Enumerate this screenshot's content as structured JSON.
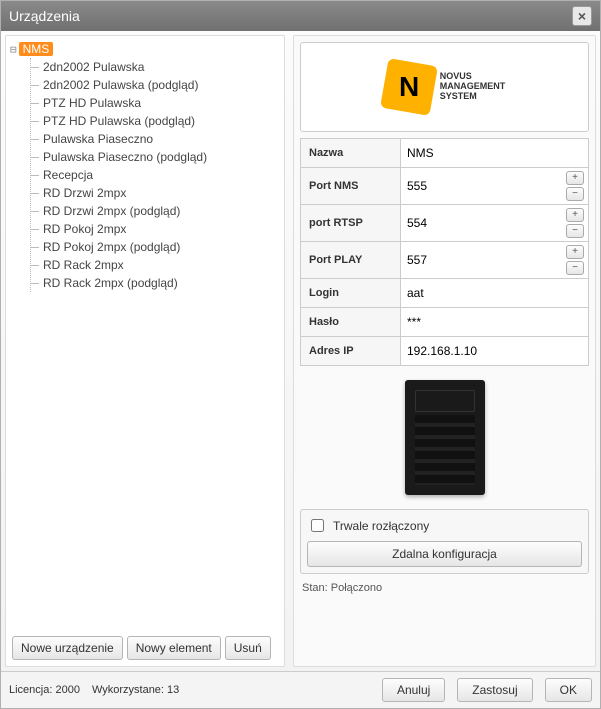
{
  "window": {
    "title": "Urządzenia"
  },
  "tree": {
    "root": "NMS",
    "items": [
      "2dn2002 Pulawska",
      "2dn2002 Pulawska (podgląd)",
      "PTZ HD Pulawska",
      "PTZ HD Pulawska (podgląd)",
      "Pulawska Piaseczno",
      "Pulawska Piaseczno (podgląd)",
      "Recepcja",
      "RD Drzwi 2mpx",
      "RD Drzwi 2mpx (podgląd)",
      "RD Pokoj 2mpx",
      "RD Pokoj 2mpx (podgląd)",
      "RD Rack 2mpx",
      "RD Rack 2mpx (podgląd)"
    ]
  },
  "left_buttons": {
    "new_device": "Nowe urządzenie",
    "new_element": "Nowy element",
    "delete": "Usuń"
  },
  "logo": {
    "letter": "N",
    "line1": "NOVUS",
    "line2": "MANAGEMENT",
    "line3": "SYSTEM"
  },
  "form": {
    "labels": {
      "name": "Nazwa",
      "port_nms": "Port NMS",
      "port_rtsp": "port RTSP",
      "port_play": "Port PLAY",
      "login": "Login",
      "password": "Hasło",
      "address": "Adres IP"
    },
    "values": {
      "name": "NMS",
      "port_nms": "555",
      "port_rtsp": "554",
      "port_play": "557",
      "login": "aat",
      "password": "***",
      "address": "192.168.1.10"
    }
  },
  "bottom": {
    "disconnected": "Trwale rozłączony",
    "remote_config": "Zdalna konfiguracja"
  },
  "status": {
    "label": "Stan:",
    "value": "Połączono"
  },
  "footer": {
    "license": "Licencja: 2000",
    "used": "Wykorzystane: 13",
    "cancel": "Anuluj",
    "apply": "Zastosuj",
    "ok": "OK"
  }
}
